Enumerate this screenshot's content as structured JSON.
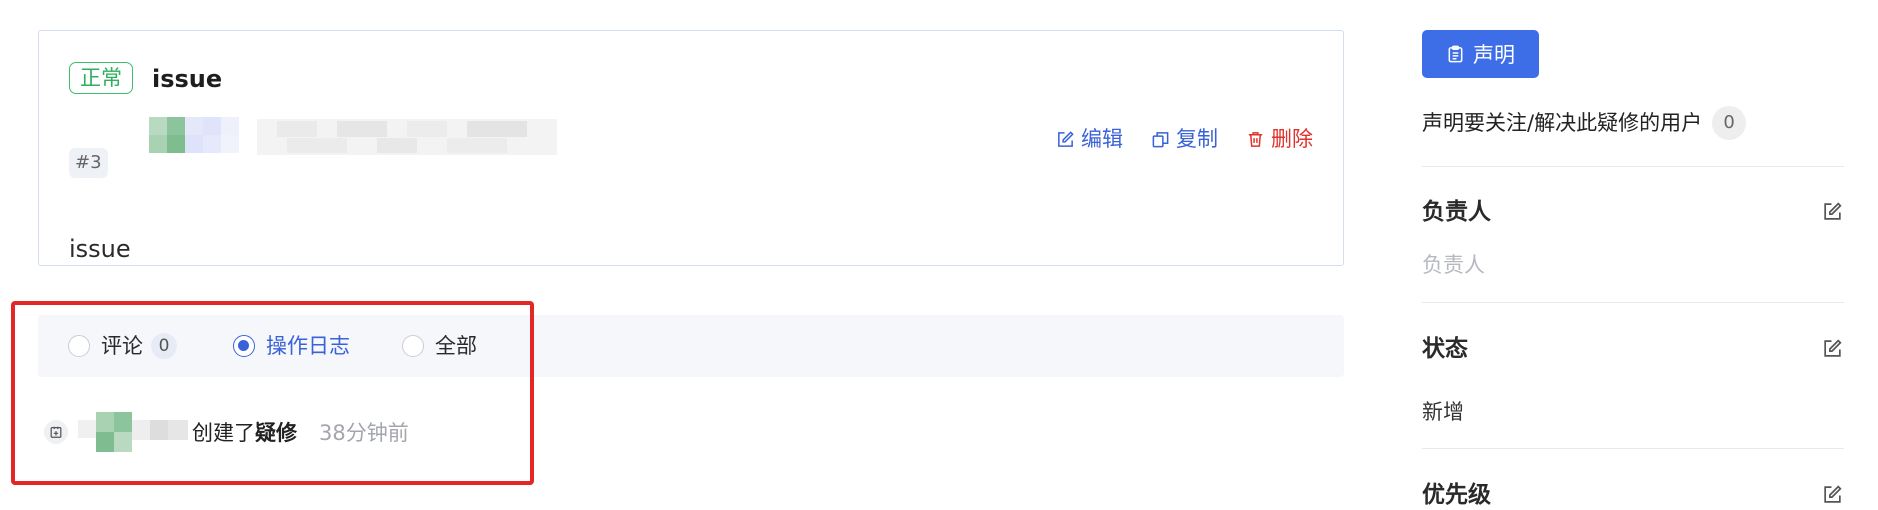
{
  "issue": {
    "status": "正常",
    "title": "issue",
    "number": "#3",
    "body": "issue",
    "actions": {
      "edit": "编辑",
      "copy": "复制",
      "delete": "删除"
    }
  },
  "activity": {
    "tabs": [
      {
        "label": "评论",
        "count": "0",
        "selected": false
      },
      {
        "label": "操作日志",
        "selected": true
      },
      {
        "label": "全部",
        "selected": false
      }
    ],
    "log": {
      "action_text": "创建了",
      "target": "疑修",
      "time": "38分钟前"
    }
  },
  "sidebar": {
    "claim_button": "声明",
    "claim_text": "声明要关注/解决此疑修的用户",
    "claim_count": "0",
    "assignee": {
      "heading": "负责人",
      "value": "负责人"
    },
    "status": {
      "heading": "状态",
      "value": "新增"
    },
    "priority": {
      "heading": "优先级"
    }
  },
  "colors": {
    "accent": "#3a62d8",
    "primary_button": "#3d6ee8",
    "danger": "#e0322a",
    "status_tag": "#2fae5e",
    "highlight": "#e32626"
  },
  "icons": [
    "edit-icon",
    "copy-icon",
    "trash-icon",
    "clipboard-icon",
    "document-add-icon"
  ]
}
